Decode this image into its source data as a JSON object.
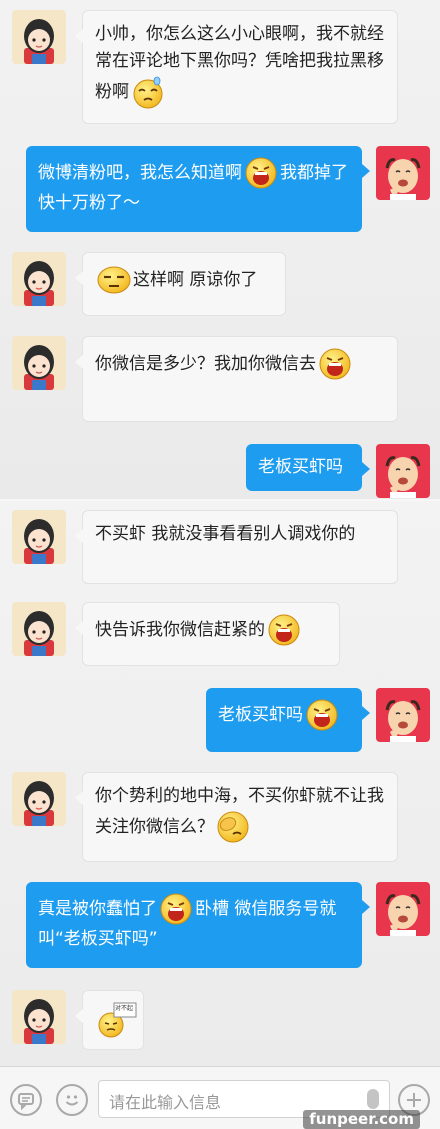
{
  "messages": [
    {
      "side": "in",
      "parts": [
        {
          "text": "小帅，你怎么这么小心眼啊，我不就经常在评论地下黑你吗？凭啥把我拉黑移粉啊"
        },
        {
          "emoji": "sweat-emoji"
        }
      ]
    },
    {
      "side": "out",
      "parts": [
        {
          "text": "微博清粉吧，我怎么知道啊"
        },
        {
          "emoji": "shouting-emoji"
        },
        {
          "text": "我都掉了快十万粉了～"
        }
      ]
    },
    {
      "side": "in",
      "parts": [
        {
          "emoji": "speechless-emoji"
        },
        {
          "text": "这样啊 原谅你了"
        }
      ]
    },
    {
      "side": "in",
      "parts": [
        {
          "text": "你微信是多少？我加你微信去"
        },
        {
          "emoji": "shouting-emoji"
        }
      ]
    },
    {
      "side": "out",
      "parts": [
        {
          "text": "老板买虾吗"
        }
      ]
    },
    {
      "side": "in",
      "parts": [
        {
          "text": "不买虾 我就没事看看别人调戏你的"
        }
      ]
    },
    {
      "side": "in",
      "parts": [
        {
          "text": "快告诉我你微信赶紧的"
        },
        {
          "emoji": "shouting-emoji"
        }
      ]
    },
    {
      "side": "out",
      "parts": [
        {
          "text": "老板买虾吗"
        },
        {
          "emoji": "shouting-emoji"
        }
      ]
    },
    {
      "side": "in",
      "parts": [
        {
          "text": "你个势利的地中海，不买你虾就不让我关注你微信么？"
        },
        {
          "emoji": "facepalm-emoji"
        }
      ]
    },
    {
      "side": "out",
      "parts": [
        {
          "text": "真是被你蠢怕了"
        },
        {
          "emoji": "shouting-emoji"
        },
        {
          "text": "卧槽  微信服务号就叫“老板买虾吗”"
        }
      ]
    },
    {
      "side": "in",
      "parts": [
        {
          "emoji": "sorry-sign-emoji",
          "sign": "对不起"
        }
      ]
    }
  ],
  "input": {
    "placeholder": "请在此输入信息",
    "left_icons": [
      "comment-icon",
      "smiley-icon"
    ],
    "right_icons": [
      "microphone-icon",
      "plus-icon"
    ]
  },
  "watermark": "funpeer.com",
  "colors": {
    "outgoing": "#1e9df0",
    "incoming": "#f7f7f7",
    "background": "#eeeeee"
  }
}
